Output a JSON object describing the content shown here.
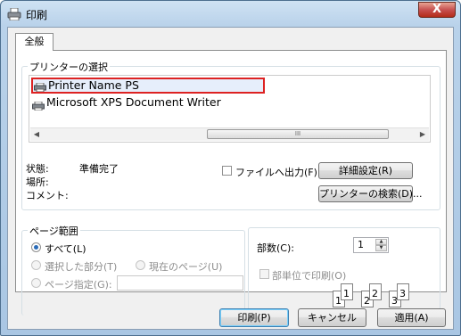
{
  "window": {
    "title": "印刷",
    "close_glyph": "X"
  },
  "tabs": [
    {
      "label": "全般"
    }
  ],
  "printer_group": {
    "title": "プリンターの選択",
    "printers": [
      {
        "name": "Printer Name PS",
        "selected": true
      },
      {
        "name": "Microsoft XPS Document Writer",
        "selected": false
      }
    ],
    "scrollbar": {
      "left_arrow": "◀",
      "right_arrow": "▶",
      "thumb_grip": "III"
    },
    "status_label": "状態:",
    "status_value": "準備完了",
    "location_label": "場所:",
    "comment_label": "コメント:",
    "print_to_file_label": "ファイルへ出力(F)",
    "preferences_button": "詳細設定(R)",
    "find_printer_button": "プリンターの検索(D)..."
  },
  "page_range_group": {
    "title": "ページ範囲",
    "all_label": "すべて(L)",
    "selection_label": "選択した部分(T)",
    "current_page_label": "現在のページ(U)",
    "pages_label": "ページ指定(G):",
    "pages_value": "",
    "selected_option": "all"
  },
  "copies_group": {
    "copies_label": "部数(C):",
    "copies_value": "1",
    "collate_label": "部単位で印刷(O)",
    "collate_checked": false,
    "collate_pages": [
      "1",
      "1",
      "2",
      "2",
      "3",
      "3"
    ]
  },
  "footer": {
    "print_button": "印刷(P)",
    "cancel_button": "キャンセル",
    "apply_button": "適用(A)"
  },
  "colors": {
    "selection_border": "#dd2222",
    "close_button": "#c75050",
    "title_bar": "#b9d2ea"
  },
  "icons": {
    "title": "printer-icon",
    "printer_item": "printer-icon"
  }
}
